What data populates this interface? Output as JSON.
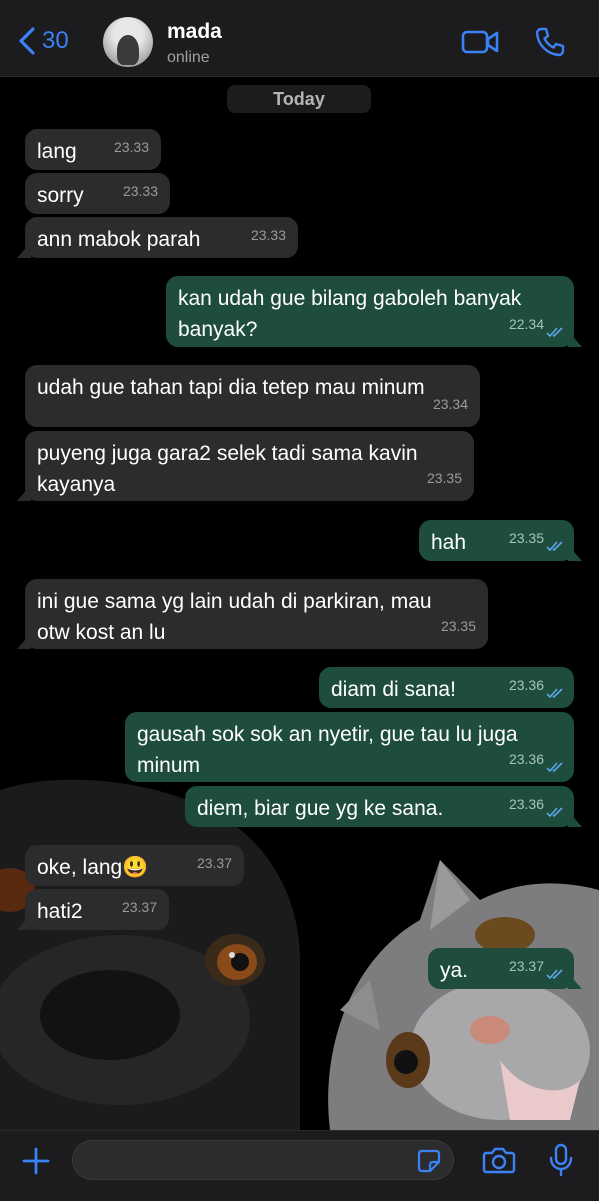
{
  "header": {
    "back_count": "30",
    "contact_name": "mada",
    "contact_status": "online"
  },
  "day_label": "Today",
  "messages": [
    {
      "text": "lang",
      "time": "23.33",
      "direction": "incoming"
    },
    {
      "text": "sorry",
      "time": "23.33",
      "direction": "incoming"
    },
    {
      "text": "ann mabok parah",
      "time": "23.33",
      "direction": "incoming"
    },
    {
      "text": "kan udah gue bilang gaboleh banyak\nbanyak?",
      "time": "22.34",
      "direction": "outgoing",
      "read": true
    },
    {
      "text": "udah gue tahan tapi dia tetep mau minum",
      "time": "23.34",
      "direction": "incoming"
    },
    {
      "text": "puyeng juga gara2 selek tadi sama kavin\nkayanya",
      "time": "23.35",
      "direction": "incoming"
    },
    {
      "text": "hah",
      "time": "23.35",
      "direction": "outgoing",
      "read": true
    },
    {
      "text": "ini gue sama yg lain udah di parkiran, mau\notw kost an lu",
      "time": "23.35",
      "direction": "incoming"
    },
    {
      "text": "diam di sana!",
      "time": "23.36",
      "direction": "outgoing",
      "read": true
    },
    {
      "text": "gausah sok sok an nyetir, gue tau lu juga\nminum",
      "time": "23.36",
      "direction": "outgoing",
      "read": true
    },
    {
      "text": "diem, biar gue yg ke sana.",
      "time": "23.36",
      "direction": "outgoing",
      "read": true
    },
    {
      "text": "oke, lang😃",
      "time": "23.37",
      "direction": "incoming"
    },
    {
      "text": "hati2",
      "time": "23.37",
      "direction": "incoming"
    },
    {
      "text": "ya.",
      "time": "23.37",
      "direction": "outgoing",
      "read": true
    }
  ],
  "colors": {
    "accent": "#3b82f6",
    "incoming_bubble": "#2c2c2e",
    "outgoing_bubble": "#1f4d3d",
    "read_ticks": "#5aa7e8"
  },
  "icons": [
    "chevron-left-icon",
    "video-call-icon",
    "phone-icon",
    "plus-icon",
    "sticker-icon",
    "camera-icon",
    "microphone-icon",
    "double-check-icon"
  ]
}
